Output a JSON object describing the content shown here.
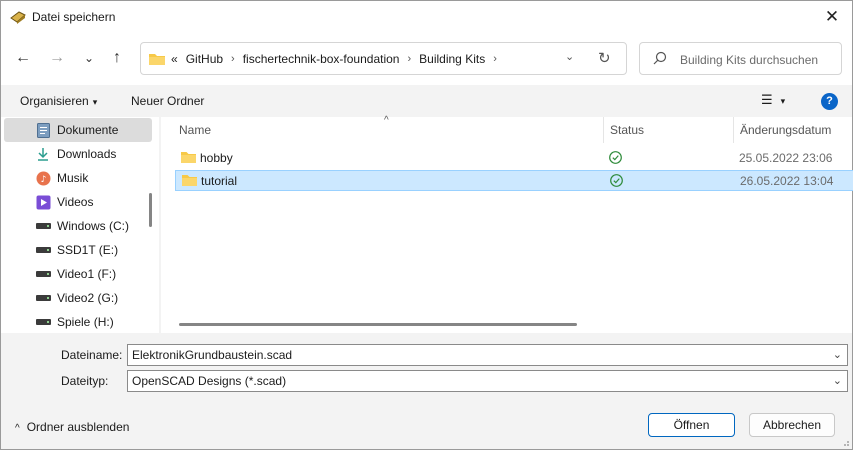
{
  "window": {
    "title": "Datei speichern",
    "close_symbol": "✕"
  },
  "nav": {
    "back_symbol": "←",
    "forward_symbol": "→",
    "recent_symbol": "⌄",
    "up_symbol": "↑",
    "overflow_symbol": "«",
    "breadcrumbs": [
      "GitHub",
      "fischertechnik-box-foundation",
      "Building Kits"
    ],
    "crumb_separator": "›",
    "dropdown_symbol": "⌄",
    "refresh_symbol": "↻",
    "search_placeholder": "Building Kits durchsuchen"
  },
  "toolbar": {
    "organize_label": "Organisieren",
    "new_folder_label": "Neuer Ordner",
    "view_symbol": "☰",
    "caret_symbol": "▾",
    "help_symbol": "?"
  },
  "sidebar": {
    "items": [
      {
        "label": "Dokumente",
        "icon": "documents-icon",
        "selected": true
      },
      {
        "label": "Downloads",
        "icon": "download-icon"
      },
      {
        "label": "Musik",
        "icon": "music-icon"
      },
      {
        "label": "Videos",
        "icon": "video-icon"
      },
      {
        "label": "Windows (C:)",
        "icon": "drive-icon"
      },
      {
        "label": "SSD1T (E:)",
        "icon": "drive-icon"
      },
      {
        "label": "Video1 (F:)",
        "icon": "drive-icon"
      },
      {
        "label": "Video2 (G:)",
        "icon": "drive-icon"
      },
      {
        "label": "Spiele (H:)",
        "icon": "drive-icon"
      }
    ]
  },
  "filelist": {
    "sort_arrow": "^",
    "columns": {
      "name": "Name",
      "status": "Status",
      "modified": "Änderungsdatum"
    },
    "rows": [
      {
        "name": "hobby",
        "status": "synced",
        "modified": "25.05.2022 23:06",
        "selected": false
      },
      {
        "name": "tutorial",
        "status": "synced",
        "modified": "26.05.2022 13:04",
        "selected": true
      }
    ]
  },
  "form": {
    "filename_label": "Dateiname:",
    "filename_value": "ElektronikGrundbaustein.scad",
    "filetype_label": "Dateityp:",
    "filetype_value": "OpenSCAD Designs (*.scad)",
    "dropdown_symbol": "⌄"
  },
  "footer": {
    "hide_folders_symbol": "^",
    "hide_folders_label": "Ordner ausblenden",
    "open_label": "Öffnen",
    "cancel_label": "Abbrechen"
  },
  "colors": {
    "accent": "#0067c0",
    "selection_bg": "#cce8ff",
    "folder": "#f7c948",
    "sync_green": "#2e8b3a"
  }
}
